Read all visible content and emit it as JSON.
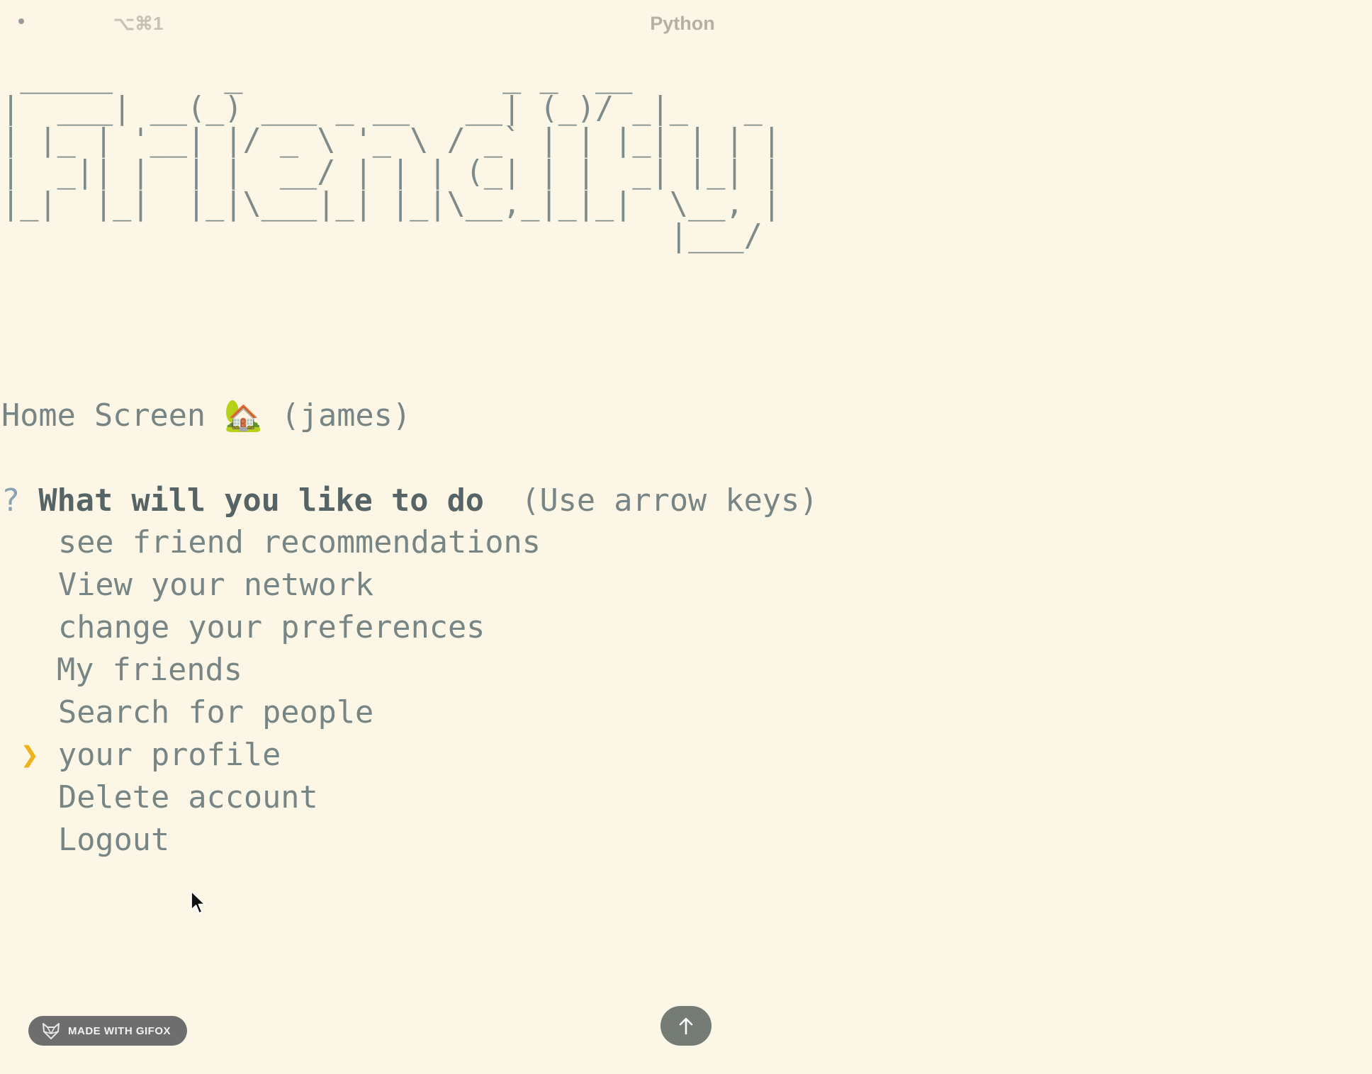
{
  "titlebar": {
    "shortcut": "⌥⌘1",
    "title": "Python"
  },
  "banner": {
    "ascii_art": " _____      _              _ _  __\n|  ___| __(_) ___ _ __   __| (_)/ _|_   _\n| |_ | '__| |/ _ \\ '_ \\ / _` | | |_| | | |\n|  _|| |  | |  __/ | | | (_| | |  _| |_| |\n|_|  |_|  |_|\\___|_| |_|\\__,_|_|_|  \\__, |\n                                    |___/"
  },
  "home": {
    "label": "Home Screen",
    "emoji": "🏡",
    "user": "(james)"
  },
  "prompt": {
    "marker": "?",
    "question": "What will you like to do",
    "hint": "(Use arrow keys)"
  },
  "menu": {
    "pointer": "❯",
    "selected_index": 5,
    "items": [
      {
        "label": "see friend recommendations"
      },
      {
        "label": "View your network"
      },
      {
        "label": "change your preferences"
      },
      {
        "label": "My friends"
      },
      {
        "label": "Search for people"
      },
      {
        "label": "your profile"
      },
      {
        "label": "Delete account"
      },
      {
        "label": "Logout"
      }
    ]
  },
  "overlay": {
    "gifox_badge": "MADE WITH GIFOX",
    "scroll_icon": "arrow-up-icon"
  },
  "colors": {
    "background": "#fcf6e7",
    "text": "#778585",
    "question": "#566465",
    "pointer": "#f0b21b"
  }
}
